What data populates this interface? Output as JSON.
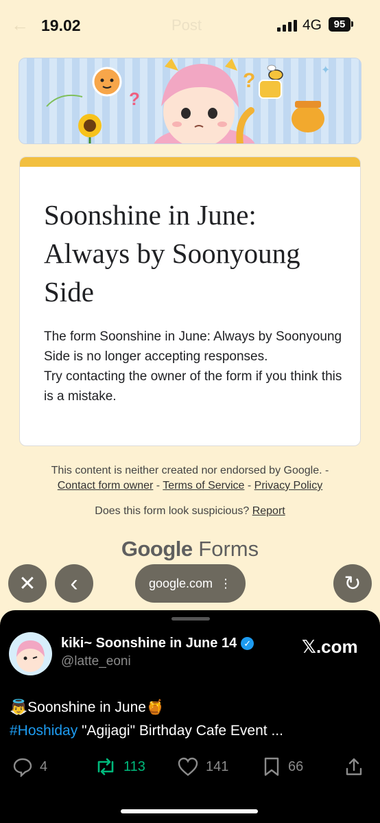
{
  "status_bar": {
    "time": "19.02",
    "page_title": "Post",
    "network": "4G",
    "battery": "95"
  },
  "form": {
    "title": "Soonshine in June: Always by Soonyoung Side",
    "message_line1": "The form Soonshine in June: Always by Soonyoung Side is no longer accepting responses.",
    "message_line2": "Try contacting the owner of the form if you think this is a mistake."
  },
  "footer": {
    "disclaimer": "This content is neither created nor endorsed by Google. -",
    "contact_link": "Contact form owner",
    "sep1": " - ",
    "terms_link": "Terms of Service",
    "sep2": " - ",
    "privacy_link": "Privacy Policy",
    "suspicious_text": "Does this form look suspicious?",
    "report_link": "Report",
    "brand_google": "Google",
    "brand_forms": "Forms"
  },
  "browser": {
    "url": "google.com",
    "more_glyph": "⋮"
  },
  "tweet": {
    "author_name": "kiki~ Soonshine in June 14",
    "handle": "@latte_eoni",
    "site": "𝕏.com",
    "line1": "👼Soonshine in June🍯",
    "hashtag": "#Hoshiday",
    "line2_rest": " \"Agijagi\" Birthday Cafe Event ...",
    "replies": "4",
    "retweets": "113",
    "likes": "141",
    "bookmarks": "66"
  },
  "colors": {
    "page_background": "#fdf1d2",
    "form_accent": "#f2bf3f",
    "link_blue": "#1d9bf0",
    "retweet_green": "#00ba7c"
  }
}
